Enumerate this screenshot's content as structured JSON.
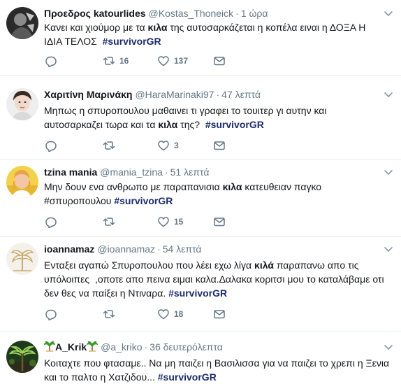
{
  "tweets": [
    {
      "name": "Προεδρος katourlides",
      "handle": "@Kostas_Thoneick",
      "time": "1 ώρα",
      "lines": [
        [
          {
            "t": "Κανει και χιούμορ με τα "
          },
          {
            "t": "κιλα",
            "k": "kw"
          },
          {
            "t": " της αυτοσαρκάζεται η κοπέλα ειναι η ΔΟΞΑ Η"
          }
        ],
        [
          {
            "t": "ΙΔΙΑ ΤΕΛΟΣ  "
          },
          {
            "t": "#survivorGR",
            "k": "tag"
          }
        ]
      ],
      "retweets": "16",
      "likes": "137"
    },
    {
      "name": "Χαριτίνη Μαρινάκη",
      "handle": "@HaraMarinaki97",
      "time": "47 λεπτά",
      "lines": [
        [
          {
            "t": "Μηπως η σπυροπουλου μαθαινει τι γραφει το τουιτερ γι αυτην και"
          }
        ],
        [
          {
            "t": "αυτοσαρκαζει τωρα και τα "
          },
          {
            "t": "κιλα",
            "k": "kw"
          },
          {
            "t": " της?  "
          },
          {
            "t": "#survivorGR",
            "k": "tag"
          }
        ]
      ],
      "retweets": "",
      "likes": "3"
    },
    {
      "name": "tzina mania",
      "handle": "@mania_tzina",
      "time": "51 λεπτά",
      "lines": [
        [
          {
            "t": "Μην δουν ενα ανθρωπο με παραπανισια "
          },
          {
            "t": "κιλα",
            "k": "kw"
          },
          {
            "t": " κατευθειαν παγκο"
          }
        ],
        [
          {
            "t": "#σπυροπουλου "
          },
          {
            "t": "#survivorGR",
            "k": "tag"
          }
        ]
      ],
      "retweets": "",
      "likes": "15"
    },
    {
      "name": "ioannamaz",
      "handle": "@ioannamaz",
      "time": "54 λεπτά",
      "lines": [
        [
          {
            "t": "Ενταξει αγαπώ Σπυροπουλου που λέει εχω λίγα "
          },
          {
            "t": "κιλά",
            "k": "kw"
          },
          {
            "t": " παραπανω απο τις"
          }
        ],
        [
          {
            "t": "υπόλοιπες  ,οποτε απο πεινα ειμαι καλα.Δαλακα κοριτσι μου το καταλάβαμε οτι"
          }
        ],
        [
          {
            "t": "δεν θες να παίξει η Ντιναρα. "
          },
          {
            "t": "#survivorGR",
            "k": "tag"
          }
        ]
      ],
      "retweets": "",
      "likes": "18"
    },
    {
      "name": "A_Krik",
      "handle": "@a_kriko",
      "time": "36 δευτερόλεπτα",
      "lines": [
        [
          {
            "t": "Κοιταχτε που φτασαμε.. Να μη παιζει η Βασιλισσα για να παιζει το χρεπι η Ξενια"
          }
        ],
        [
          {
            "t": "και το παλτο η Χατζιδου... "
          },
          {
            "t": "#survivorGR",
            "k": "tag"
          }
        ]
      ]
    }
  ],
  "colors": {
    "hashtag": "#1c2b6b",
    "meta": "#657786",
    "icon": "#657786",
    "divider": "#e6ecf0"
  },
  "icons": [
    "reply-icon",
    "retweet-icon",
    "like-icon",
    "mail-icon",
    "chevron-down-icon",
    "palm-tree-emoji"
  ]
}
